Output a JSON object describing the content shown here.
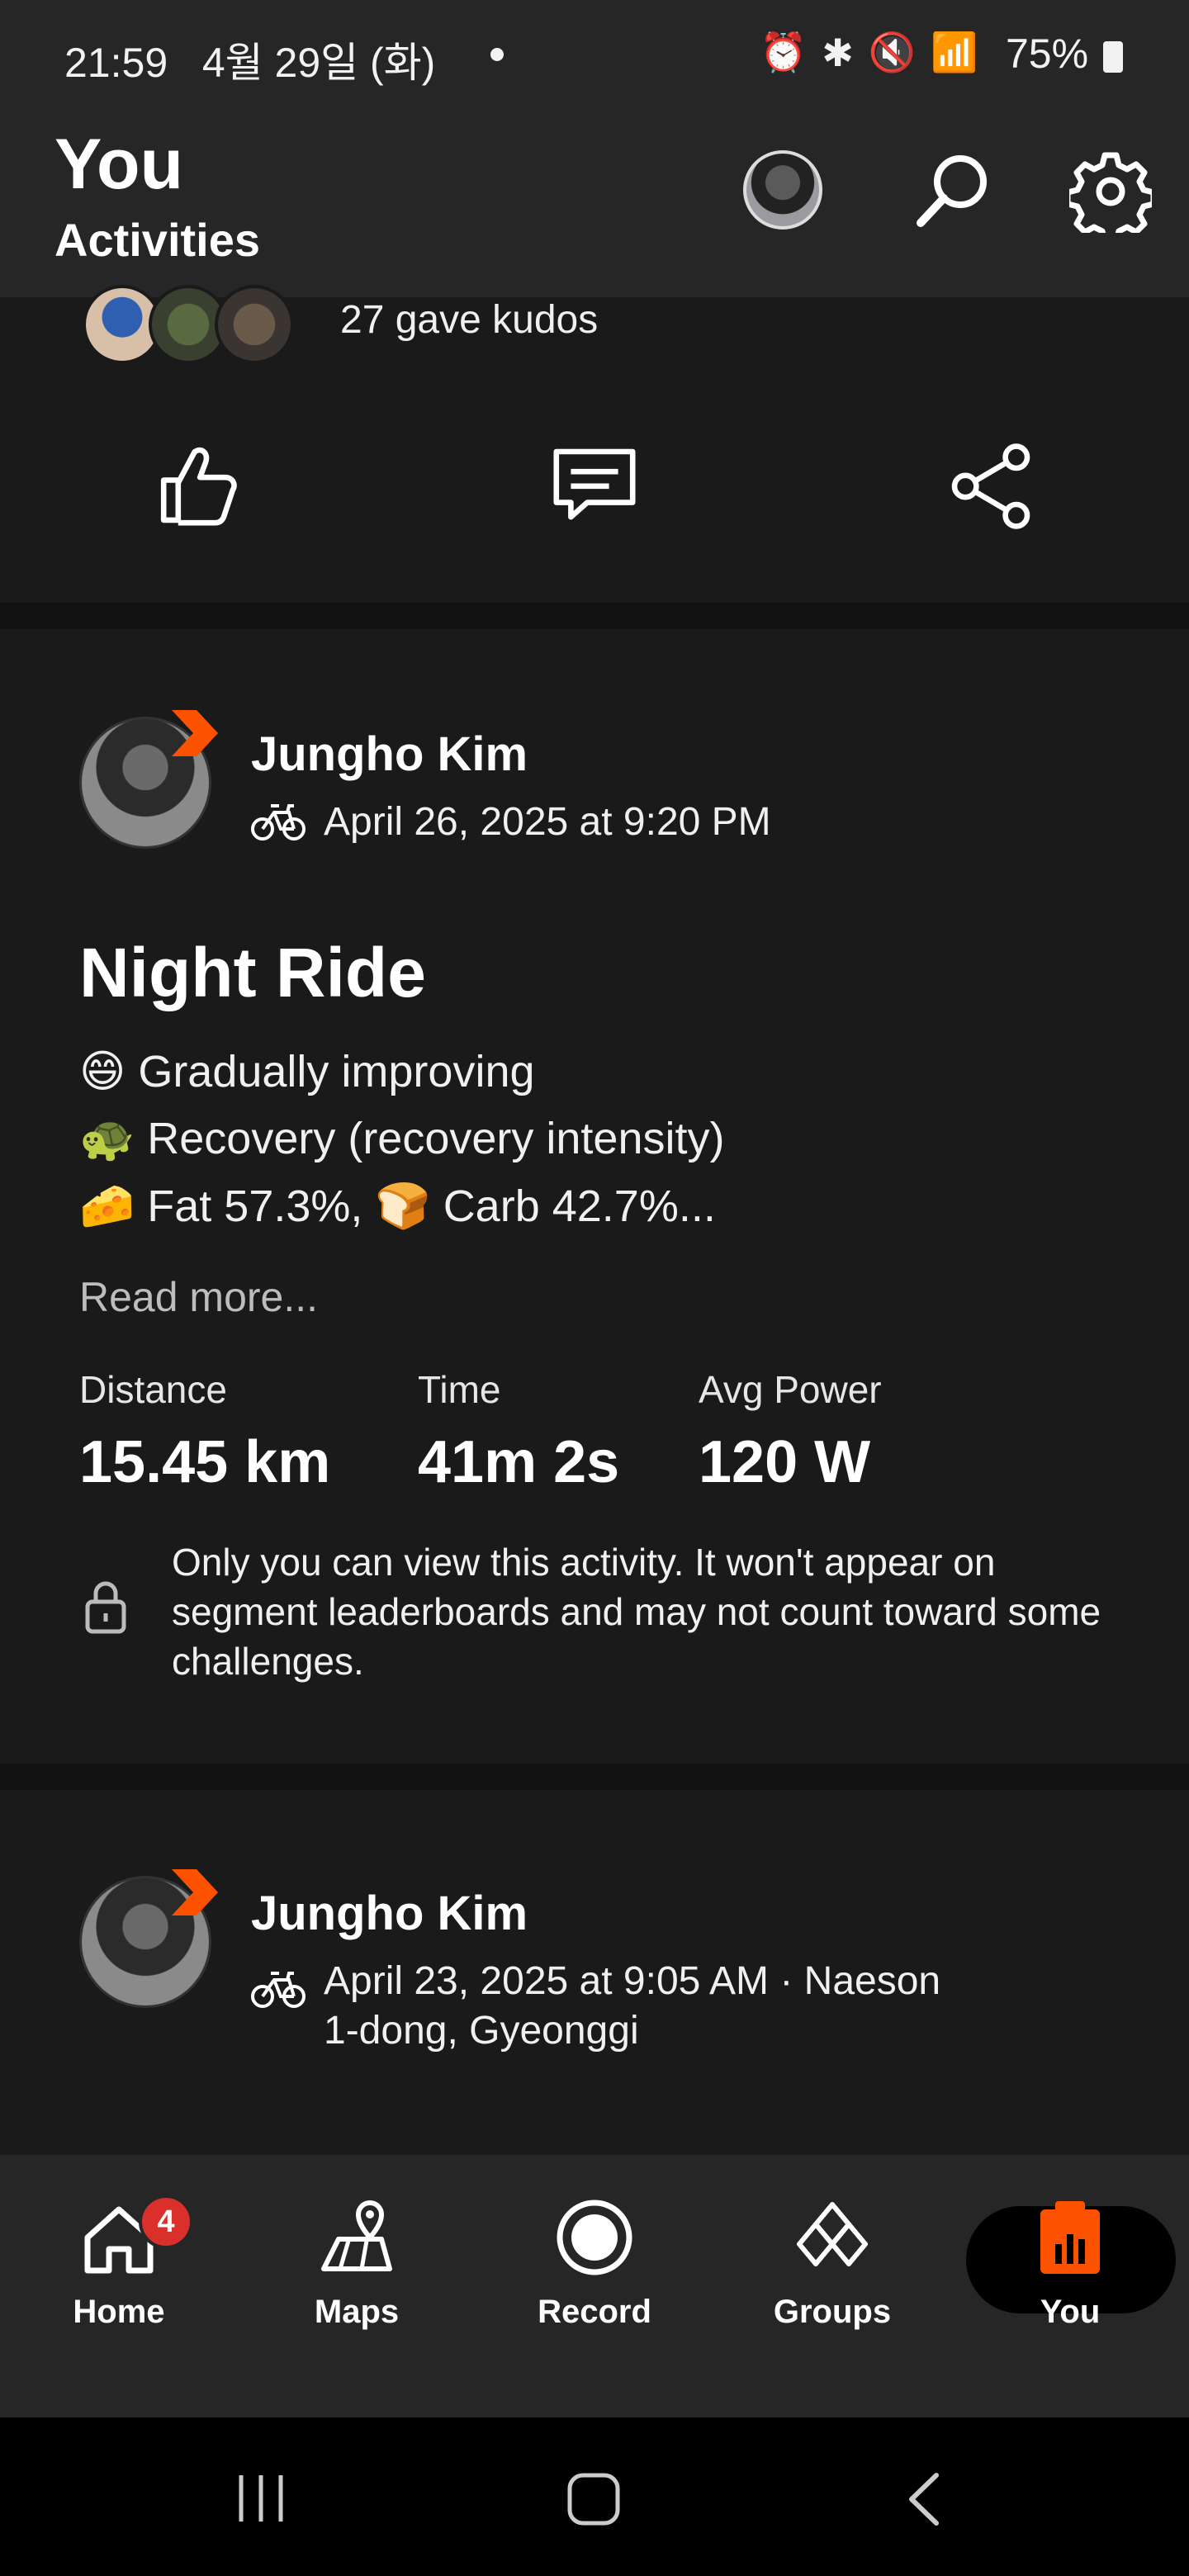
{
  "status_bar": {
    "time": "21:59",
    "date": "4월 29일 (화)",
    "battery": "75%"
  },
  "header": {
    "title": "You",
    "subtitle": "Activities"
  },
  "previous_post": {
    "kudos_text": "27 gave kudos"
  },
  "posts": [
    {
      "athlete": "Jungho Kim",
      "date": "April 26, 2025 at 9:20 PM",
      "title": "Night Ride",
      "description": [
        {
          "emoji": "😄",
          "text": "Gradually improving"
        },
        {
          "emoji": "🐢",
          "text": "Recovery (recovery intensity)"
        },
        {
          "emoji": "🧀",
          "text": "Fat 57.3%, ",
          "emoji2": "🍞",
          "text2": "Carb 42.7%..."
        }
      ],
      "read_more": "Read more...",
      "stats": [
        {
          "label": "Distance",
          "value": "15.45 km"
        },
        {
          "label": "Time",
          "value": "41m 2s"
        },
        {
          "label": "Avg Power",
          "value": "120 W"
        }
      ],
      "privacy_note": "Only you can view this activity. It won't appear on segment leaderboards and may not count toward some challenges."
    },
    {
      "athlete": "Jungho Kim",
      "date_line1": "April 23, 2025 at 9:05 AM · Naeson",
      "date_line2": "1-dong, Gyeonggi"
    }
  ],
  "bottom_nav": {
    "items": [
      {
        "label": "Home",
        "icon": "home-icon",
        "badge": "4"
      },
      {
        "label": "Maps",
        "icon": "map-icon"
      },
      {
        "label": "Record",
        "icon": "record-icon"
      },
      {
        "label": "Groups",
        "icon": "groups-icon"
      },
      {
        "label": "You",
        "icon": "you-icon",
        "active": true
      }
    ]
  },
  "colors": {
    "accent": "#fc5200",
    "badge_red": "#d9302b",
    "background": "#111111",
    "card": "#1a1a1a",
    "bar": "#262626"
  }
}
